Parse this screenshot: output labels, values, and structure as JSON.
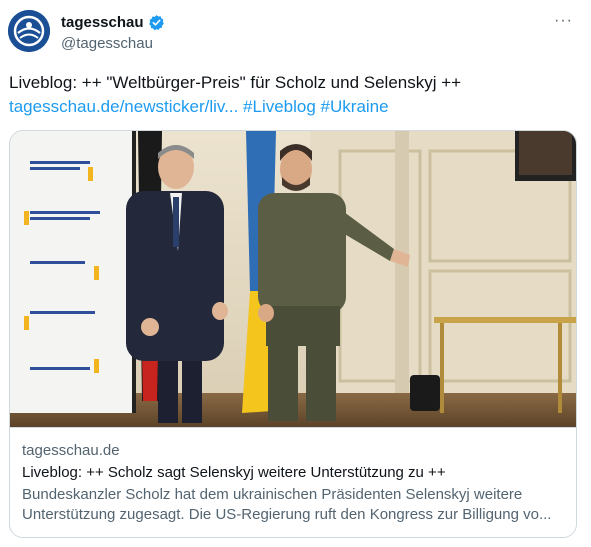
{
  "author": {
    "display_name": "tagesschau",
    "handle": "@tagesschau",
    "avatar_icon": "tagesschau-logo-icon",
    "verified_icon": "verified-badge-icon",
    "verified_color": "#1d9bf0"
  },
  "menu": {
    "more_label": "···"
  },
  "tweet": {
    "text": "Liveblog: ++ \"Weltbürger-Preis\" für Scholz und Selenskyj ++",
    "link": "tagesschau.de/newsticker/liv...",
    "hashtags": [
      "#Liveblog",
      "#Ukraine"
    ]
  },
  "card": {
    "domain": "tagesschau.de",
    "title": "Liveblog: ++ Scholz sagt Selenskyj weitere Unterstützung zu ++",
    "description": "Bundeskanzler Scholz hat dem ukrainischen Präsidenten Selenskyj weitere Unterstützung zugesagt. Die US-Regierung ruft den Kongress zur Billigung vo..."
  },
  "colors": {
    "link": "#1d9bf0",
    "secondary_text": "#536471",
    "border": "#cfd9de",
    "avatar_bg": "#1a4f96"
  }
}
